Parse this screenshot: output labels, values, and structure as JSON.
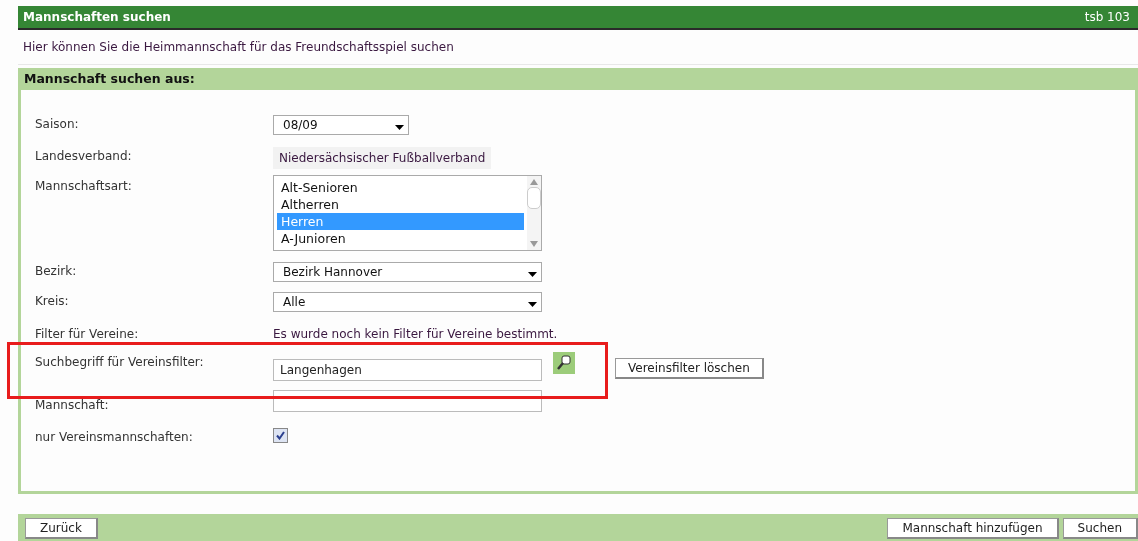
{
  "header": {
    "title": "Mannschaften suchen",
    "code": "tsb 103"
  },
  "intro": "Hier können Sie die Heimmannschaft für das Freundschaftsspiel suchen",
  "panel": {
    "title": "Mannschaft suchen aus:",
    "fields": [
      {
        "kind": "select",
        "label": "Saison:",
        "value": "08/09"
      },
      {
        "kind": "static",
        "label": "Landesverband:",
        "value": "Niedersächsischer Fußballverband"
      },
      {
        "kind": "listbox",
        "label": "Mannschaftsart:",
        "options": [
          {
            "label": "Alt-Senioren",
            "selected": false
          },
          {
            "label": "Altherren",
            "selected": false
          },
          {
            "label": "Herren",
            "selected": true
          },
          {
            "label": "A-Junioren",
            "selected": false
          }
        ]
      },
      {
        "kind": "wideselect",
        "label": "Bezirk:",
        "value": "Bezirk Hannover"
      },
      {
        "kind": "wideselect",
        "label": "Kreis:",
        "value": "Alle"
      },
      {
        "kind": "text",
        "label": "Filter für Vereine:",
        "value": "Es wurde noch kein Filter für Vereine bestimmt."
      },
      {
        "kind": "search",
        "label": "Suchbegriff für Vereinsfilter:",
        "value": "Langenhagen",
        "button": "Vereinsfilter löschen"
      },
      {
        "kind": "input",
        "label": "Mannschaft:"
      },
      {
        "kind": "checkbox",
        "label": "nur Vereinsmannschaften:",
        "checked": true
      }
    ]
  },
  "footer": {
    "left_buttons": [
      "Zurück"
    ],
    "right_buttons": [
      "Mannschaft hinzufügen",
      "Suchen"
    ]
  }
}
